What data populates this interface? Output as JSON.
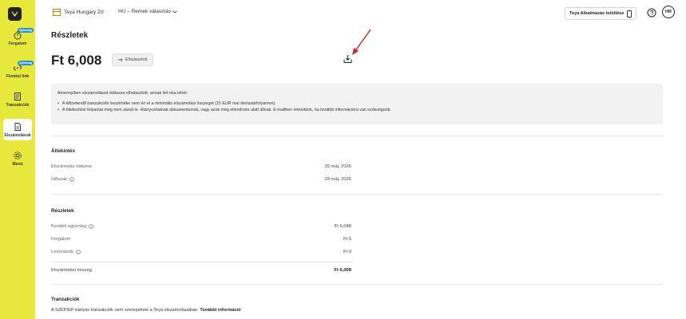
{
  "sidebar": {
    "items": [
      {
        "label": "Forgalom",
        "badge": "Újdonság"
      },
      {
        "label": "Fizetési link",
        "badge": "Újdonság"
      },
      {
        "label": "Tranzakciók"
      },
      {
        "label": "Elszámolások"
      },
      {
        "label": "Menü"
      }
    ]
  },
  "header": {
    "company": "Teya Hungary Zrt",
    "region": "HU – Remek választás",
    "app_download": "Teya Alkalmazás letöltése",
    "avatar": "HR"
  },
  "page": {
    "title": "Részletek",
    "amount": "Ft 6,008",
    "status": "Elhalasztott"
  },
  "notice": {
    "intro": "Amennyiben elszámolásod státusza elhalasztott, annak két oka lehet:",
    "bullets": [
      "A kifizetendő tranzakciók összértéke nem éri el a minimális elszámolási összeget (15 EUR mai devizaárfolyamon).",
      "A hitelesítési folyamat még nem zárult le. Hiányozhatnak dokumentumok, vagy azok még ellenőrzés alatt állnak. E-mailben értesítünk, ha további információra van szükségünk."
    ]
  },
  "overview": {
    "title": "Áttekintés",
    "rows": [
      {
        "label": "Elszámolás dátuma",
        "value": "30 máj. 2025"
      },
      {
        "label": "Időszak",
        "value": "29 máj. 2025"
      }
    ]
  },
  "details": {
    "title": "Részletek",
    "rows": [
      {
        "label": "Kezdeti egyenleg",
        "value": "Ft 6,048"
      },
      {
        "label": "Forgalom",
        "value": "Ft 5"
      },
      {
        "label": "Levonások",
        "value": "Ft 0"
      }
    ],
    "total_label": "Elszámolási összeg",
    "total_value": "Ft 6,008"
  },
  "transactions": {
    "title": "Tranzakciók",
    "note": "A SZÉP/EP kártyás tranzakciók nem szerepelnek a Teya elszámolásaiban.",
    "link": "További információ"
  },
  "colors": {
    "sidebar": "#e6e83c",
    "annotation_arrow": "#e02020",
    "badge": "#2c8fd6"
  }
}
